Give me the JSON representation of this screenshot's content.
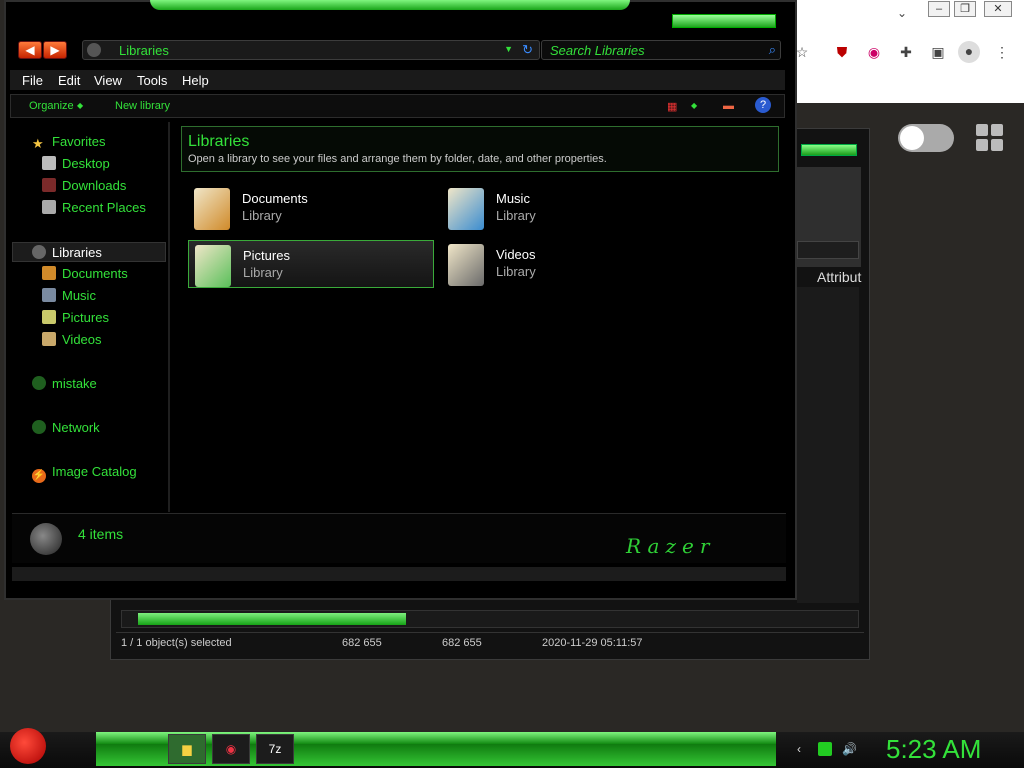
{
  "explorer": {
    "address_text": "Libraries",
    "search_placeholder": "Search Libraries",
    "menu": [
      "File",
      "Edit",
      "View",
      "Tools",
      "Help"
    ],
    "commands": {
      "organize": "Organize",
      "new_library": "New library"
    },
    "sidebar": {
      "favorites": "Favorites",
      "desktop": "Desktop",
      "downloads": "Downloads",
      "recent_places": "Recent Places",
      "libraries": "Libraries",
      "documents": "Documents",
      "music": "Music",
      "pictures": "Pictures",
      "videos": "Videos",
      "mistake": "mistake",
      "network": "Network",
      "image_catalog": "Image Catalog"
    },
    "banner": {
      "title": "Libraries",
      "desc": "Open a library to see your files and arrange them by folder, date, and other properties."
    },
    "libraries": [
      {
        "name": "Documents",
        "type": "Library"
      },
      {
        "name": "Music",
        "type": "Library"
      },
      {
        "name": "Pictures",
        "type": "Library"
      },
      {
        "name": "Videos",
        "type": "Library"
      }
    ],
    "status_count": "4 items",
    "brand": "Razer"
  },
  "back_window": {
    "attr_header": "Attribut",
    "progress_fraction": 0.38,
    "status": [
      "1 / 1 object(s) selected",
      "682 655",
      "682 655",
      "2020-11-29 05:11:57"
    ]
  },
  "taskbar": {
    "clock": "5:23 AM",
    "seven_zip": "7z"
  },
  "colors": {
    "accent": "#33e13a",
    "background": "#000000"
  },
  "icons": {
    "back": "arrow-left-icon",
    "forward": "arrow-right-icon",
    "search": "search-icon",
    "refresh": "refresh-icon",
    "help": "help-icon",
    "star": "star-icon"
  }
}
